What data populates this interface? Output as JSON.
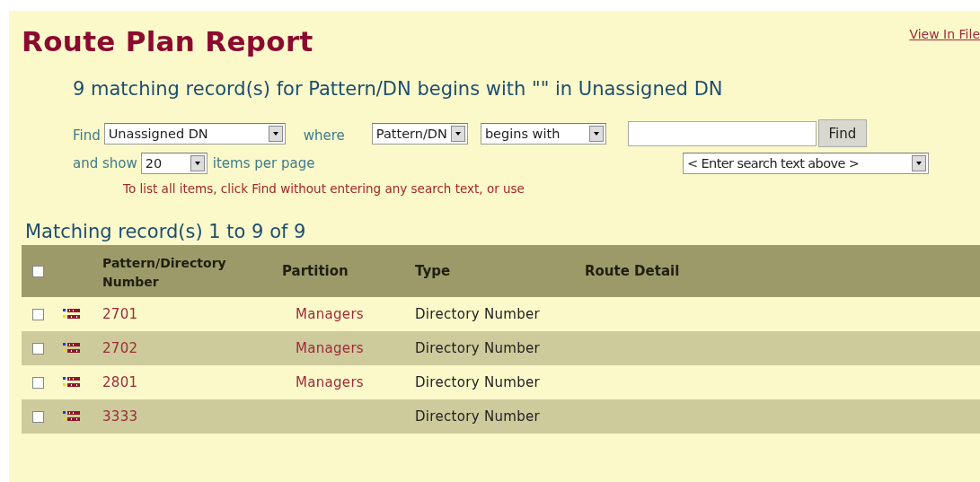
{
  "title": "Route Plan Report",
  "view_link": "View In File",
  "summary": "9 matching record(s) for Pattern/DN begins with \"\" in Unassigned DN",
  "search": {
    "find_label": "Find",
    "find_in": "Unassigned DN",
    "where_label": "where",
    "field": "Pattern/DN",
    "operator": "begins with",
    "find_button": "Find",
    "show_label": "and show",
    "show_count": "20",
    "per_page_label": "items per page",
    "recent": "< Enter search text above >",
    "hint": "To list all items, click Find without entering any search text, or use"
  },
  "results_heading": "Matching record(s) 1 to 9 of 9",
  "table": {
    "select_all": {
      "checked": false
    },
    "columns": [
      "Pattern/Directory Number",
      "Partition",
      "Type",
      "Route Detail"
    ],
    "rows": [
      {
        "checked": false,
        "pattern": "2701",
        "partition": "Managers",
        "type": "Directory Number"
      },
      {
        "checked": false,
        "pattern": "2702",
        "partition": "Managers",
        "type": "Directory Number"
      },
      {
        "checked": false,
        "pattern": "2801",
        "partition": "Managers",
        "type": "Directory Number"
      },
      {
        "checked": false,
        "pattern": "3333",
        "type": "Directory Number"
      }
    ]
  }
}
